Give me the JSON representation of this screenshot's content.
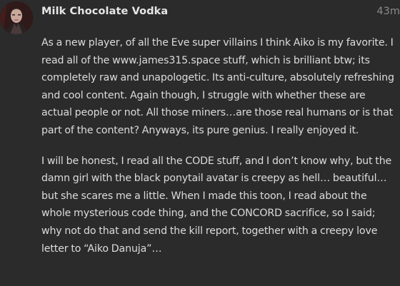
{
  "post": {
    "author": "Milk Chocolate Vodka",
    "timestamp": "43m",
    "avatar_icon": "user-avatar-icon",
    "paragraphs": [
      "As a new player, of all the Eve super villains I think Aiko is my favorite. I read all of the www.james315.space stuff, which is brilliant btw; its completely raw and unapologetic. Its anti-culture, absolutely refreshing and cool content. Again though, I struggle with whether these are actual people or not. All those miners…are those real humans or is that part of the content? Anyways, its pure genius. I really enjoyed it.",
      "I will be honest, I read all the CODE stuff, and I don’t know why, but the damn girl with the black ponytail avatar is creepy as hell… beautiful…but she scares me a little. When I made this toon, I read about the whole mysterious code thing, and the CONCORD sacrifice, so I said; why not do that and send the kill report, together with a creepy love letter to “Aiko Danuja”…"
    ]
  },
  "colors": {
    "background": "#2b2b2b",
    "text": "#dcdcdc",
    "author": "#e6e6e6",
    "timestamp": "#8a8a8a"
  }
}
